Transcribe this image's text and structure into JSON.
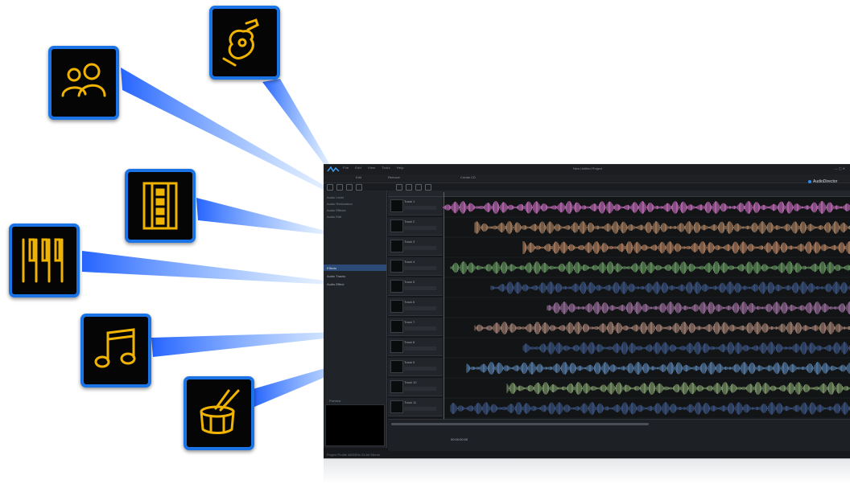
{
  "brand": {
    "name": "AudioDirector"
  },
  "menu": [
    "File",
    "Edit",
    "View",
    "Tools",
    "Help"
  ],
  "window_title": "New Untitled Project",
  "toolbar": {
    "edit_label": "Edit",
    "remove_label": "Remove",
    "tab_label": "Create CD"
  },
  "side_panel": {
    "items": [
      "Audio Level",
      "Audio Restoration",
      "Audio Effects",
      "Audio Edit"
    ],
    "section_label": "Effects",
    "sub_items": [
      "Audio Tracks",
      "Audio Effect"
    ],
    "preview_label": "Preview"
  },
  "tracks": [
    {
      "name": "Track 1",
      "color": "#d274c8"
    },
    {
      "name": "Track 2",
      "color": "#b48a68"
    },
    {
      "name": "Track 3",
      "color": "#bf8a68"
    },
    {
      "name": "Track 4",
      "color": "#6fa368"
    },
    {
      "name": "Track 5",
      "color": "#3f5a8c"
    },
    {
      "name": "Track 6",
      "color": "#a776a8"
    },
    {
      "name": "Track 7",
      "color": "#b08a7c"
    },
    {
      "name": "Track 8",
      "color": "#3f5a8c"
    },
    {
      "name": "Track 9",
      "color": "#5d88b8"
    },
    {
      "name": "Track 10",
      "color": "#8aa873"
    },
    {
      "name": "Track 11",
      "color": "#3f5a8c"
    }
  ],
  "time_readout": "00:00:00:00",
  "status_text": "Project Profile 48000Hz 24-bit Stereo",
  "callouts": [
    {
      "id": "guitar",
      "icon": "guitar-icon"
    },
    {
      "id": "voice",
      "icon": "people-icon"
    },
    {
      "id": "film",
      "icon": "film-strip-icon"
    },
    {
      "id": "piano",
      "icon": "piano-keys-icon"
    },
    {
      "id": "music",
      "icon": "music-note-icon"
    },
    {
      "id": "drum",
      "icon": "drum-icon"
    }
  ],
  "colors": {
    "tile_border": "#1b74e6",
    "icon_gold": "#f0b400",
    "beam": "#2a74ff"
  }
}
